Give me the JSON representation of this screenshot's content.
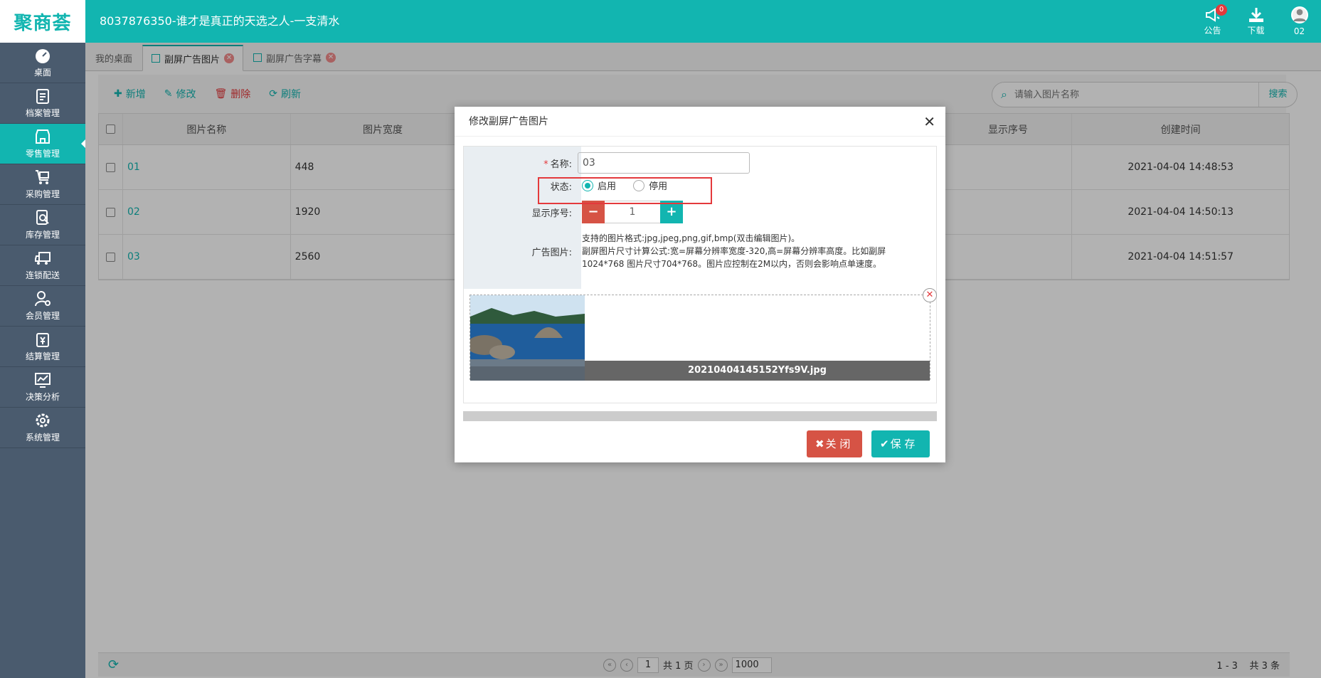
{
  "app": {
    "logo": "聚商荟",
    "title": "8037876350-谁才是真正的天选之人-一支清水"
  },
  "topbar": {
    "notice_label": "公告",
    "notice_count": "0",
    "download_label": "下载",
    "user_label": "02"
  },
  "sidebar": {
    "items": [
      {
        "label": "桌面",
        "icon": "dashboard-icon"
      },
      {
        "label": "档案管理",
        "icon": "archive-icon"
      },
      {
        "label": "零售管理",
        "icon": "store-icon",
        "active": true
      },
      {
        "label": "采购管理",
        "icon": "cart-icon"
      },
      {
        "label": "库存管理",
        "icon": "inventory-icon"
      },
      {
        "label": "连锁配送",
        "icon": "truck-icon"
      },
      {
        "label": "会员管理",
        "icon": "member-icon"
      },
      {
        "label": "结算管理",
        "icon": "settlement-icon"
      },
      {
        "label": "决策分析",
        "icon": "analysis-icon"
      },
      {
        "label": "系统管理",
        "icon": "settings-icon"
      }
    ]
  },
  "tabs": [
    {
      "label": "我的桌面"
    },
    {
      "label": "副屏广告图片",
      "active": true
    },
    {
      "label": "副屏广告字幕"
    }
  ],
  "toolbar": {
    "add": "新增",
    "edit": "修改",
    "delete": "删除",
    "refresh": "刷新"
  },
  "search": {
    "placeholder": "请输入图片名称",
    "button": "搜索"
  },
  "grid": {
    "columns": [
      "图片名称",
      "图片宽度",
      "显示序号",
      "创建时间"
    ],
    "rows": [
      {
        "name": "01",
        "width": "448",
        "created": "2021-04-04 14:48:53"
      },
      {
        "name": "02",
        "width": "1920",
        "created": "2021-04-04 14:50:13"
      },
      {
        "name": "03",
        "width": "2560",
        "created": "2021-04-04 14:51:57"
      }
    ]
  },
  "pager": {
    "page": "1",
    "total_pages": "共 1 页",
    "page_size": "1000",
    "range": "1 - 3",
    "total": "共 3 条"
  },
  "dialog": {
    "title": "修改副屏广告图片",
    "name_label": "名称:",
    "name_value": "03",
    "status_label": "状态:",
    "status_enabled": "启用",
    "status_disabled": "停用",
    "status_selected": "启用",
    "order_label": "显示序号:",
    "order_value": "1",
    "image_label": "广告图片:",
    "hint_line1": "支持的图片格式:jpg,jpeg,png,gif,bmp(双击编辑图片)。",
    "hint_line2": "副屏图片尺寸计算公式:宽=屏幕分辨率宽度-320,高=屏幕分辨率高度。比如副屏1024*768 图片尺寸704*768。图片应控制在2M以内，否则会影响点单速度。",
    "file_name": "20210404145152Yfs9V.jpg",
    "close_button": "关 闭",
    "save_button": "保 存"
  },
  "colors": {
    "accent": "#12b5b0",
    "sidebar": "#4a5b6e",
    "danger": "#d65345"
  }
}
